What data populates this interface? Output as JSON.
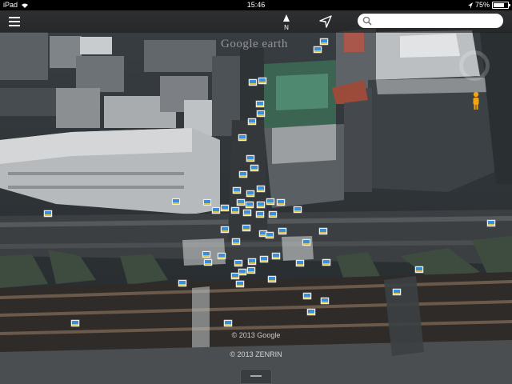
{
  "status_bar": {
    "carrier": "iPad",
    "time": "15:46",
    "battery": "75%",
    "battery_level": 0.75
  },
  "toolbar": {
    "menu_icon": "menu-icon",
    "north_label": "N",
    "north_icon": "compass-north-icon",
    "locate_icon": "location-arrow-icon"
  },
  "search": {
    "icon": "search-icon",
    "placeholder": "",
    "value": ""
  },
  "map": {
    "watermark": "Google earth",
    "copyright_google": "© 2013 Google",
    "copyright_zenrin": "© 2013 ZENRIN",
    "photo_marker_icon": "photo-marker-icon",
    "photo_marker_color": "#3a8fd8"
  },
  "controls": {
    "compass_ring_icon": "compass-ring-icon",
    "pegman_icon": "pegman-icon",
    "pegman_color": "#f2a414",
    "drawer_handle_icon": "drawer-handle-icon"
  }
}
